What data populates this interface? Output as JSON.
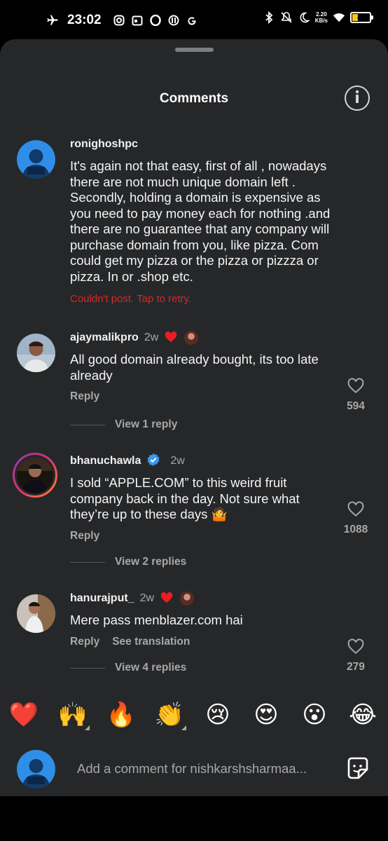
{
  "status": {
    "time": "23:02",
    "speed_value": "2.20",
    "speed_unit": "KB/s",
    "battery": "40",
    "battery_level": 0.4
  },
  "sheet": {
    "title": "Comments"
  },
  "comments": [
    {
      "username": "ronighoshpc",
      "text": "It's again not that easy, first of all , nowadays there are not much unique domain left . Secondly, holding a domain is expensive as you need to pay money each for nothing .and there are no guarantee that any company will purchase domain from you, like pizza. Com could get my pizza or the pizza or pizzza or pizza. In or .shop etc.",
      "error": "Couldn't post. Tap to retry."
    },
    {
      "username": "ajaymalikpro",
      "time": "2w",
      "text": "All good domain already bought, its too late already",
      "reply": "Reply",
      "likes": "594",
      "view_replies": "View 1 reply"
    },
    {
      "username": "bhanuchawla",
      "time": "2w",
      "text": "I sold “APPLE.COM” to this weird fruit company back in the day. Not sure what they’re up to these days 🤷",
      "reply": "Reply",
      "likes": "1088",
      "view_replies": "View 2 replies"
    },
    {
      "username": "hanurajput_",
      "time": "2w",
      "text": "Mere pass menblazer.com hai",
      "reply": "Reply",
      "see_translation": "See translation",
      "likes": "279",
      "view_replies": "View 4 replies"
    }
  ],
  "emojis": [
    "❤️",
    "🙌",
    "🔥",
    "👏",
    "😢",
    "😍",
    "😮",
    "😂"
  ],
  "composer": {
    "placeholder": "Add a comment for nishkarshsharmaa..."
  },
  "icons": {
    "airplane": "airplane-icon",
    "info": "info-icon",
    "heart_outline": "heart-outline-icon",
    "heart_filled": "heart-filled-icon",
    "verified": "verified-badge-icon",
    "sticker": "sticker-icon"
  },
  "colors": {
    "sheet_bg": "#262729",
    "error": "#d12b2b",
    "heart": "#ed1c24",
    "verified": "#3897f0",
    "muted": "#a8a8a8",
    "battery": "#f3c623"
  }
}
